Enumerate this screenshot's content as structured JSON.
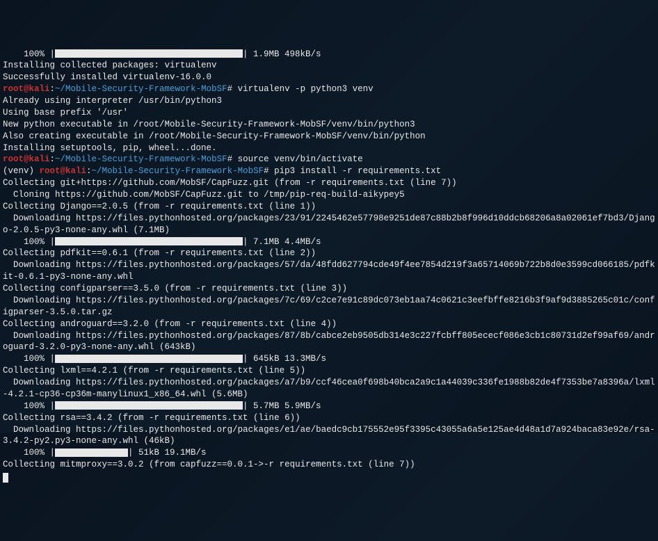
{
  "lines": {
    "l0a": "    100% |",
    "l0b": "| 1.9MB 498kB/s",
    "l1": "Installing collected packages: virtualenv",
    "l2": "Successfully installed virtualenv-16.0.0",
    "p1_user": "root@kali",
    "p1_sep": ":",
    "p1_path": "~/Mobile-Security-Framework-MobSF",
    "p1_hash": "#",
    "p1_cmd": " virtualenv -p python3 venv",
    "l4": "Already using interpreter /usr/bin/python3",
    "l5": "Using base prefix '/usr'",
    "l6": "New python executable in /root/Mobile-Security-Framework-MobSF/venv/bin/python3",
    "l7": "Also creating executable in /root/Mobile-Security-Framework-MobSF/venv/bin/python",
    "l8": "Installing setuptools, pip, wheel...done.",
    "p2_user": "root@kali",
    "p2_sep": ":",
    "p2_path": "~/Mobile-Security-Framework-MobSF",
    "p2_hash": "#",
    "p2_cmd": " source venv/bin/activate",
    "p3_venv": "(venv) ",
    "p3_user": "root@kali",
    "p3_sep": ":",
    "p3_path": "~/Mobile-Security-Framework-MobSF",
    "p3_hash": "#",
    "p3_cmd": " pip3 install -r requirements.txt",
    "l11": "Collecting git+https://github.com/MobSF/CapFuzz.git (from -r requirements.txt (line 7))",
    "l12": "  Cloning https://github.com/MobSF/CapFuzz.git to /tmp/pip-req-build-aikypey5",
    "l13": "Collecting Django==2.0.5 (from -r requirements.txt (line 1))",
    "l14": "  Downloading https://files.pythonhosted.org/packages/23/91/2245462e57798e9251de87c88b2b8f996d10ddcb68206a8a02061ef7bd3/Django-2.0.5-py3-none-any.whl (7.1MB)",
    "l15a": "    100% |",
    "l15b": "| 7.1MB 4.4MB/s",
    "l16": "Collecting pdfkit==0.6.1 (from -r requirements.txt (line 2))",
    "l17": "  Downloading https://files.pythonhosted.org/packages/57/da/48fdd627794cde49f4ee7854d219f3a65714069b722b8d0e3599cd066185/pdfkit-0.6.1-py3-none-any.whl",
    "l18": "Collecting configparser==3.5.0 (from -r requirements.txt (line 3))",
    "l19": "  Downloading https://files.pythonhosted.org/packages/7c/69/c2ce7e91c89dc073eb1aa74c0621c3eefbffe8216b3f9af9d3885265c01c/configparser-3.5.0.tar.gz",
    "l20": "Collecting androguard==3.2.0 (from -r requirements.txt (line 4))",
    "l21": "  Downloading https://files.pythonhosted.org/packages/87/8b/cabce2eb9505db314e3c227fcbff805ececf086e3cb1c80731d2ef99af69/androguard-3.2.0-py3-none-any.whl (643kB)",
    "l22a": "    100% |",
    "l22b": "| 645kB 13.3MB/s",
    "l23": "Collecting lxml==4.2.1 (from -r requirements.txt (line 5))",
    "l24": "  Downloading https://files.pythonhosted.org/packages/a7/b9/ccf46cea0f698b40bca2a9c1a44039c336fe1988b82de4f7353be7a8396a/lxml-4.2.1-cp36-cp36m-manylinux1_x86_64.whl (5.6MB)",
    "l25a": "    100% |",
    "l25b": "| 5.7MB 5.9MB/s",
    "l26": "Collecting rsa==3.4.2 (from -r requirements.txt (line 6))",
    "l27": "  Downloading https://files.pythonhosted.org/packages/e1/ae/baedc9cb175552e95f3395c43055a6a5e125ae4d48a1d7a924baca83e92e/rsa-3.4.2-py2.py3-none-any.whl (46kB)",
    "l28a": "    100% |",
    "l28b": "| 51kB 19.1MB/s",
    "l29": "Collecting mitmproxy==3.0.2 (from capfuzz==0.0.1->-r requirements.txt (line 7))"
  }
}
